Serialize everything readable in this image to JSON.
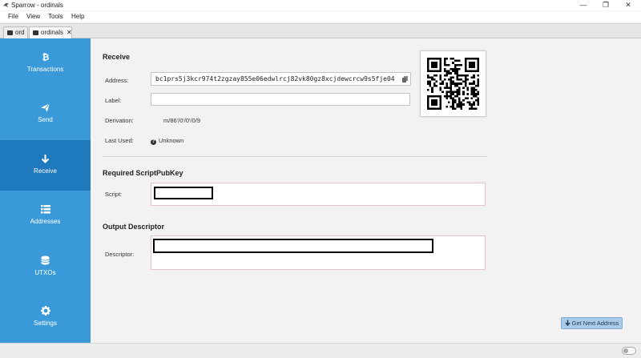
{
  "window": {
    "title": "Sparrow - ordinals",
    "minimize": "—",
    "maximize": "❐",
    "close": "✕"
  },
  "menu": [
    "File",
    "View",
    "Tools",
    "Help"
  ],
  "tabs": [
    {
      "label": "ord",
      "active": false
    },
    {
      "label": "ordinals",
      "active": true,
      "close": "✕"
    }
  ],
  "sidebar": {
    "items": [
      {
        "label": "Transactions",
        "icon": "bitcoin-icon"
      },
      {
        "label": "Send",
        "icon": "paper-plane-icon"
      },
      {
        "label": "Receive",
        "icon": "arrow-down-icon",
        "active": true
      },
      {
        "label": "Addresses",
        "icon": "list-icon"
      },
      {
        "label": "UTXOs",
        "icon": "coins-icon"
      },
      {
        "label": "Settings",
        "icon": "gear-icon"
      }
    ]
  },
  "receive": {
    "title": "Receive",
    "address_label": "Address:",
    "address_value": "bc1prs5j3kcr974t2zgzay855e06edwlrcj82vk80gz8xcjdewcrcw9s5fje04",
    "label_label": "Label:",
    "label_value": "",
    "derivation_label": "Derivation:",
    "derivation_value": "m/86'/0'/0'/0/9",
    "last_used_label": "Last Used:",
    "last_used_value": "Unknown"
  },
  "script_section": {
    "title": "Required ScriptPubKey",
    "script_label": "Script:"
  },
  "descriptor_section": {
    "title": "Output Descriptor",
    "descriptor_label": "Descriptor:"
  },
  "actions": {
    "get_next_address": "Get Next Address"
  },
  "colors": {
    "sidebar": "#3a9ad9",
    "sidebar_active": "#1f79bd",
    "button": "#a9cbe8"
  }
}
